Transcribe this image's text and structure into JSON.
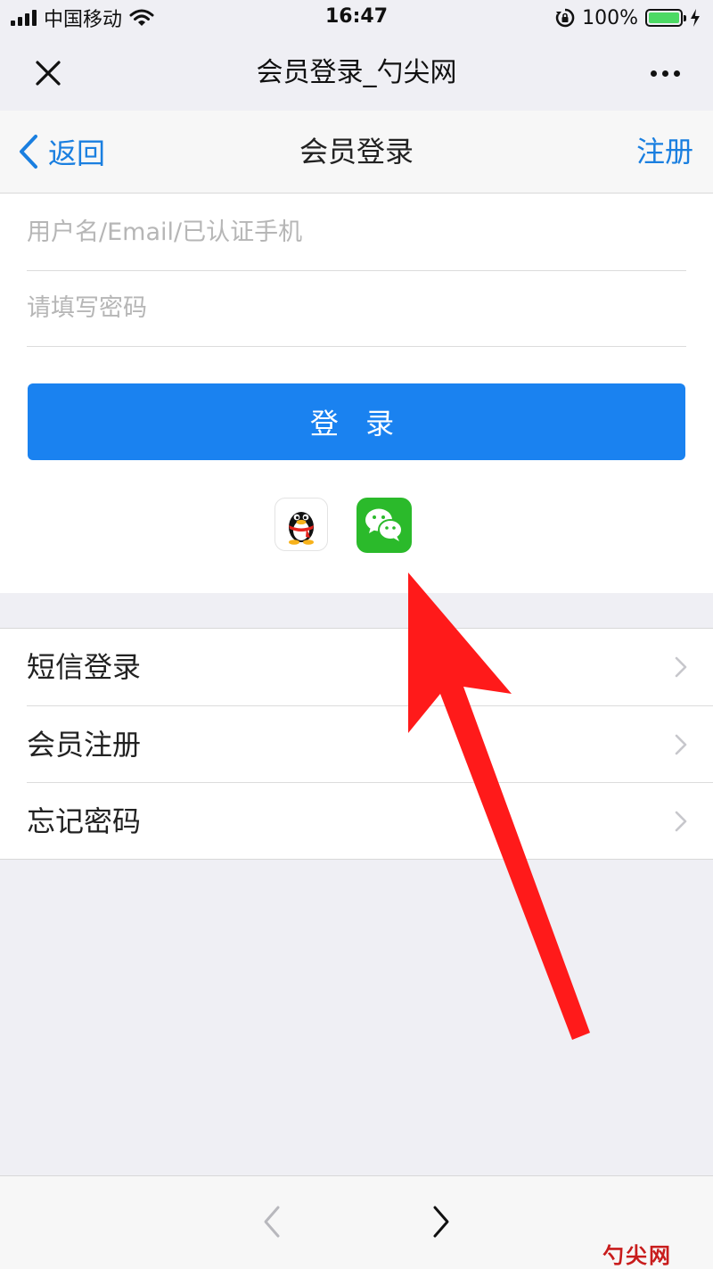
{
  "status_bar": {
    "carrier": "中国移动",
    "time": "16:47",
    "battery": "100%",
    "battery_level": 1.0
  },
  "wechat_bar": {
    "title": "会员登录_勺尖网",
    "close_icon": "close-icon",
    "more_icon": "more-dots-icon"
  },
  "nav": {
    "back_label": "返回",
    "title": "会员登录",
    "register_label": "注册"
  },
  "login_form": {
    "username_placeholder": "用户名/Email/已认证手机",
    "username_value": "",
    "password_placeholder": "请填写密码",
    "password_value": "",
    "login_label": "登 录"
  },
  "social_login": {
    "qq_icon": "qq-penguin-icon",
    "wechat_icon": "wechat-icon"
  },
  "menu": {
    "items": [
      {
        "label": "短信登录"
      },
      {
        "label": "会员注册"
      },
      {
        "label": "忘记密码"
      }
    ]
  },
  "toolbar": {
    "back_icon": "chevron-left-icon",
    "forward_icon": "chevron-right-icon"
  },
  "watermark": "勺尖网",
  "colors": {
    "accent": "#1a82f0",
    "wechat_green": "#2bba2b",
    "arrow_red": "#ff1a1a",
    "background": "#efeff4"
  }
}
